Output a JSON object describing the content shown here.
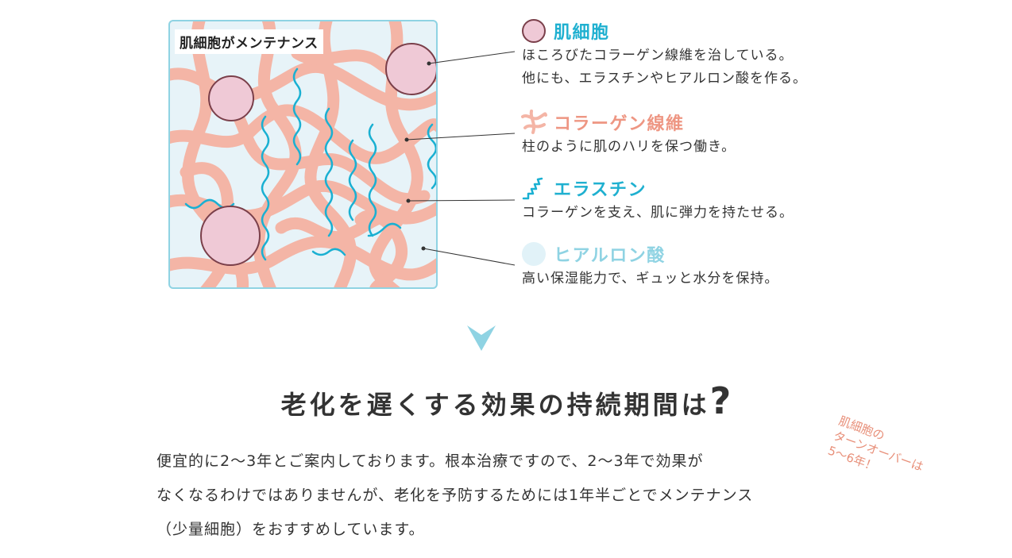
{
  "diagram": {
    "title": "肌細胞がメンテナンス"
  },
  "legend": [
    {
      "name": "肌細胞",
      "icon": "cell-icon",
      "color": "#1fb0d0",
      "description": [
        "ほころびたコラーゲン線維を治している。",
        "他にも、エラスチンやヒアルロン酸を作る。"
      ]
    },
    {
      "name": "コラーゲン線維",
      "icon": "collagen-fiber-icon",
      "color": "#ee9683",
      "description": [
        "柱のように肌のハリを保つ働き。"
      ]
    },
    {
      "name": "エラスチン",
      "icon": "elastin-icon",
      "color": "#1fb0d0",
      "description": [
        "コラーゲンを支え、肌に弾力を持たせる。"
      ]
    },
    {
      "name": "ヒアルロン酸",
      "icon": "hyaluronic-acid-icon",
      "color": "#8fd3e3",
      "description": [
        "高い保湿能力で、ギュッと水分を保持。"
      ]
    }
  ],
  "section": {
    "title": "老化を遅くする効果の持続期間は",
    "title_mark": "?",
    "body": [
      "便宜的に2〜3年とご案内しております。根本治療ですので、2〜3年で効果が",
      "なくなるわけではありませんが、老化を予防するためには1年半ごとでメンテナンス",
      "（少量細胞）をおすすめしています。"
    ]
  },
  "side_note": [
    "肌細胞の",
    "ターンオーバーは",
    "5〜6年！"
  ],
  "colors": {
    "collagen": "#f4b5a6",
    "elastin": "#1ab0d2",
    "cell_fill": "#efc9d6",
    "cell_stroke": "#7a3f4a",
    "background": "#e7f3f8",
    "frame": "#8fd3e3",
    "chevron": "#8fd3e3",
    "note": "#e8907a"
  }
}
